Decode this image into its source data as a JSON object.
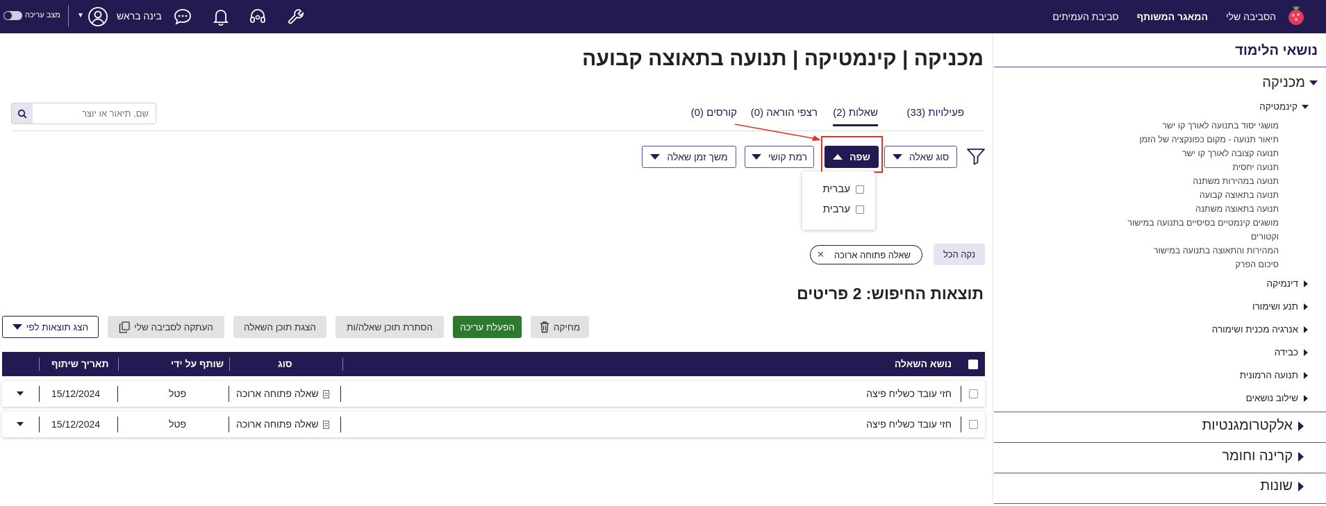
{
  "topbar": {
    "nav": [
      "הסביבה שלי",
      "המאגר המשותף",
      "סביבת העמיתים"
    ],
    "active_nav": "המאגר המשותף",
    "user_name": "בינה בראש",
    "edit_mode_label": "מצב עריכה",
    "icons": [
      "wrench-icon",
      "headset-icon",
      "bell-icon",
      "chat-icon",
      "user-icon"
    ],
    "brand_color": "#231a52"
  },
  "sidebar": {
    "title": "נושאי הלימוד",
    "topics": {
      "mechanics": "מכניקה",
      "kinematics": "קינמטיקה",
      "kinematics_items": [
        "מושגי יסוד בתנועה לאורך קו ישר",
        "תיאור תנועה - מקום כפונקציה של הזמן",
        "תנועה קצובה לאורך קו ישר",
        "תנועה יחסית",
        "תנועה במהירות משתנה",
        "תנועה בתאוצה קבועה",
        "תנועה בתאוצה משתנה",
        "מושגים קינמטיים בסיסיים בתנועה במישור",
        "וקטורים",
        "המהירות והתאוצה בתנועה במישור",
        "סיכום הפרק"
      ],
      "mechanics_sub": [
        "דינמיקה",
        "תנע ושימורו",
        "אנרגיה מכנית ושימורה",
        "כבידה",
        "תנועה הרמונית",
        "שילוב נושאים"
      ],
      "top_level": [
        "אלקטרומגנטיות",
        "קרינה וחומר",
        "שונות"
      ]
    }
  },
  "main": {
    "page_title": "מכניקה | קינמטיקה | תנועה בתאוצה קבועה",
    "tabs": [
      "פעילויות (33)",
      "שאלות (2)",
      "רצפי הוראה (0)",
      "קורסים (0)"
    ],
    "active_tab": "שאלות (2)",
    "search_placeholder": "שם, תיאור או יוצר",
    "filters": {
      "question_type": "סוג שאלה",
      "language": "שפה",
      "difficulty": "רמת קושי",
      "duration": "משך זמן שאלה"
    },
    "language_options": [
      "עברית",
      "ערבית"
    ],
    "clear_all": "נקה הכל",
    "active_chip": "שאלה פתוחה ארוכה",
    "results_title": "תוצאות החיפוש: 2 פריטים",
    "actions": {
      "delete": "מחיקה",
      "enable_edit": "הפעלת עריכה",
      "hide_content": "הסתרת תוכן שאלה/ות",
      "show_content": "הצגת תוכן השאלה",
      "copy": "העתקה לסביבה שלי",
      "sort": "הצג תוצאות לפי"
    },
    "table": {
      "headers": [
        "נושא השאלה",
        "סוג",
        "שותף על ידי",
        "תאריך שיתוף"
      ],
      "rows": [
        [
          "חזי עובד כשליח פיצה",
          "שאלה פתוחה ארוכה",
          "פטל",
          "15/12/2024"
        ],
        [
          "חזי עובד כשליח פיצה",
          "שאלה פתוחה ארוכה",
          "פטל",
          "15/12/2024"
        ]
      ]
    }
  }
}
